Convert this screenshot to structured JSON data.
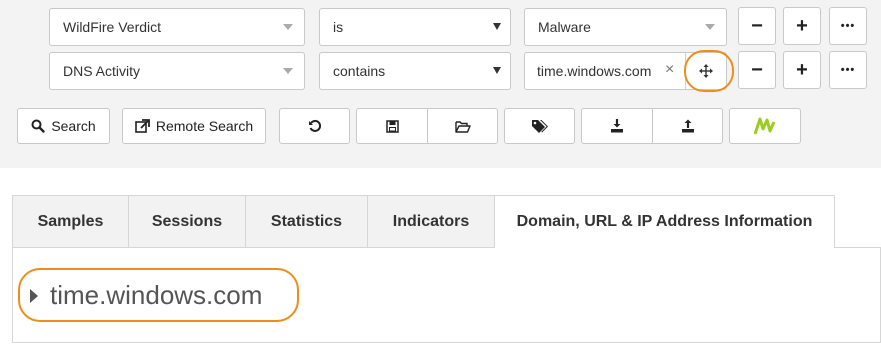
{
  "filters": [
    {
      "field": "WildFire Verdict",
      "operator": "is",
      "value": "Malware"
    },
    {
      "field": "DNS Activity",
      "operator": "contains",
      "value": "time.windows.com"
    }
  ],
  "row_buttons": {
    "minus": "−",
    "plus": "+",
    "more": "•••"
  },
  "actions": {
    "search": "Search",
    "remote_search": "Remote Search"
  },
  "tabs": [
    {
      "label": "Samples"
    },
    {
      "label": "Sessions"
    },
    {
      "label": "Statistics"
    },
    {
      "label": "Indicators"
    },
    {
      "label": "Domain, URL & IP Address Information",
      "active": true
    }
  ],
  "result": {
    "domain": "time.windows.com"
  },
  "colors": {
    "highlight": "#f08c1a",
    "logo_green": "#9ccc1f"
  },
  "icons": [
    "search-icon",
    "external-link-icon",
    "history-icon",
    "save-icon",
    "folder-open-icon",
    "tags-icon",
    "download-icon",
    "upload-icon",
    "autofocus-logo-icon",
    "move-icon",
    "clear-icon",
    "caret-right-icon"
  ]
}
